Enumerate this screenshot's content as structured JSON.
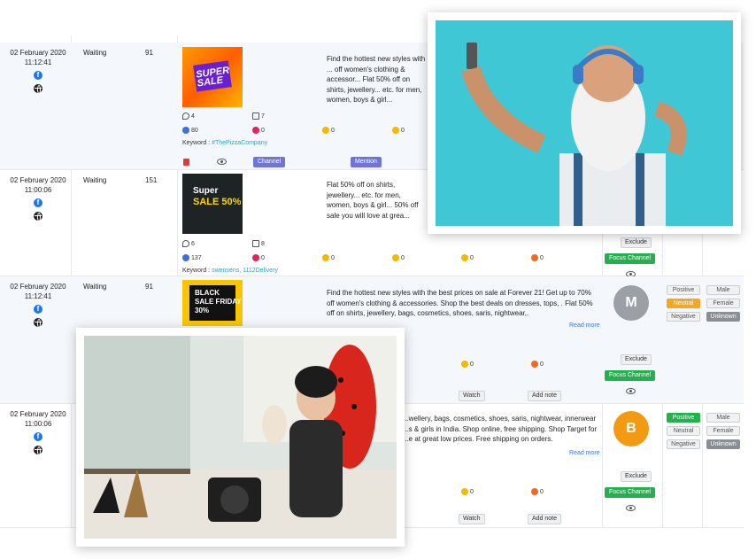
{
  "rows": [
    {
      "date": "02 February 2020",
      "time": "11:12:41",
      "status": "Waiting",
      "count": "91",
      "image_text_a": "SUPER",
      "image_text_b": "SALE",
      "comments": "4",
      "shares": "7",
      "likes": "80",
      "loves": "0",
      "haha": "0",
      "wow": "0",
      "keyword_label": "Keyword : ",
      "keyword": "#ThePizzaCompany",
      "channel_label": "Channel",
      "mention_label": "Mention",
      "description": "Find the hottest new styles with ... off women's clothing & accessor... Flat 50% off on shirts, jewellery... etc. for men, women, boys & girl..."
    },
    {
      "date": "02 February 2020",
      "time": "11:00:06",
      "status": "Waiting",
      "count": "151",
      "image_text_a": "Super",
      "image_text_b": "SALE 50%",
      "comments": "6",
      "shares": "8",
      "likes": "137",
      "loves": "0",
      "haha": "0",
      "wow": "0",
      "sad": "0",
      "angry": "0",
      "keyword_label": "Keyword : ",
      "keyword": "swensens, 1112Delivery",
      "description": "Flat 50% off on shirts, jewellery... etc. for men, women, boys & girl... 50% off sale you will love at grea...",
      "exclude_label": "Exclude",
      "focus_label": "Focus Channel"
    },
    {
      "date": "02 February 2020",
      "time": "11:12:41",
      "status": "Waiting",
      "count": "91",
      "image_text_a": "BLACK",
      "image_text_b": "SALE FRIDAY 30%",
      "description": "Find the hottest new styles with the best prices on sale at Forever 21! Get up to 70% off women's clothing & accessories. Shop the best deals on dresses, tops, . Flat 50% off on shirts, jewellery, bags, cosmetics, shoes, saris, nightwear,.",
      "read_more": "Read more",
      "sad": "0",
      "angry": "0",
      "watch_label": "Watch",
      "add_note_label": "Add note",
      "avatar_letter": "M",
      "exclude_label": "Exclude",
      "focus_label": "Focus Channel",
      "sentiment": [
        "Positive",
        "Neutral",
        "Negative"
      ],
      "gender": [
        "Male",
        "Female",
        "Unknown"
      ]
    },
    {
      "date": "02 February 2020",
      "time": "11:00:06",
      "description": "...wellery, bags, cosmetics, shoes, saris, nightwear, innerwear ...s & girls in India. Shop online, free shipping. Shop Target for ...e at great low prices. Free shipping on orders.",
      "read_more": "Read more",
      "sad": "0",
      "angry": "0",
      "watch_label": "Watch",
      "add_note_label": "Add note",
      "avatar_letter": "B",
      "exclude_label": "Exclude",
      "focus_label": "Focus Channel",
      "sentiment": [
        "Positive",
        "Neutral",
        "Negative"
      ],
      "gender": [
        "Male",
        "Female",
        "Unknown"
      ]
    }
  ],
  "colors": {
    "accent_purple": "#6f74d6",
    "focus_green": "#22b14c",
    "neutral_orange": "#f5a623",
    "avatar_grey": "#9aa0a6",
    "avatar_orange": "#f29a12",
    "link_blue": "#3b77d8"
  },
  "icons": [
    "facebook-icon",
    "globe-icon",
    "comment-icon",
    "share-icon",
    "like-icon",
    "love-icon",
    "haha-icon",
    "wow-icon",
    "sad-icon",
    "angry-icon",
    "delete-icon",
    "eye-icon"
  ]
}
